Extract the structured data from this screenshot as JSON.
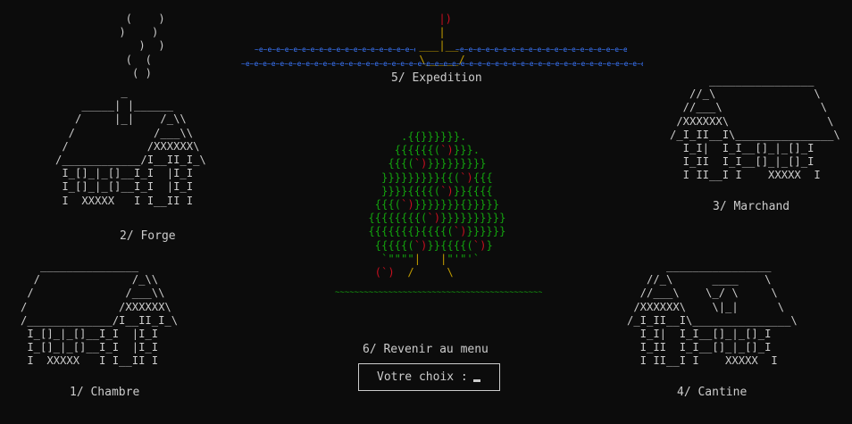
{
  "menu": {
    "chambre": "1/ Chambre",
    "forge": "2/ Forge",
    "marchand": "3/ Marchand",
    "cantine": "4/ Cantine",
    "expedition": "5/ Expedition",
    "retour": "6/ Revenir au menu"
  },
  "prompt": {
    "label": "Votre choix :"
  },
  "colors": {
    "background": "#0c0c0c",
    "text": "#cccccc",
    "tree": "#13a10e",
    "fruit": "#c50f1f",
    "boat": "#c19c00",
    "water": "#3b78ff"
  }
}
